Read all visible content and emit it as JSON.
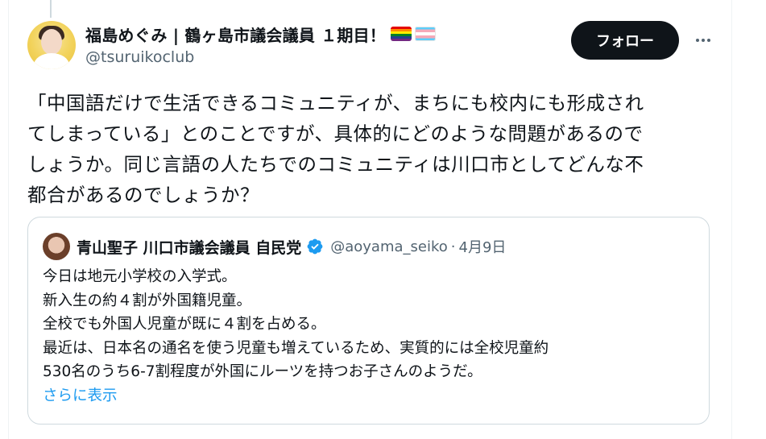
{
  "tweet": {
    "author": {
      "display_name": "福島めぐみ | 鶴ヶ島市議会議員 １期目！",
      "handle": "@tsuruikoclub",
      "avatar_icon": "user-avatar",
      "flags": [
        "rainbow-flag-icon",
        "transgender-flag-icon"
      ]
    },
    "follow_label": "フォロー",
    "more_icon": "more-options-icon",
    "text": "「中国語だけで生活できるコミュニティが、まちにも校内にも形成され\nてしまっている」とのことですが、具体的にどのような問題があるので\nしょうか。同じ言語の人たちでのコミュニティは川口市としてどんな不\n都合があるのでしょうか？"
  },
  "quoted": {
    "display_name": "青山聖子 川口市議会議員 自民党",
    "verified": true,
    "handle": "@aoyama_seiko",
    "separator": "·",
    "date": "4月9日",
    "lines": [
      "今日は地元小学校の入学式。",
      "新入生の約４割が外国籍児童。",
      "全校でも外国人児童が既に４割を占める。",
      "最近は、日本名の通名を使う児童も増えているため、実質的には全校児童約",
      "530名のうち6-7割程度が外国にルーツを持つお子さんのようだ。"
    ],
    "show_more": "さらに表示"
  },
  "colors": {
    "text": "#0f1419",
    "secondary": "#536471",
    "link": "#1d9bf0",
    "border": "#cfd9de",
    "button_bg": "#0f1419",
    "button_text": "#ffffff"
  }
}
